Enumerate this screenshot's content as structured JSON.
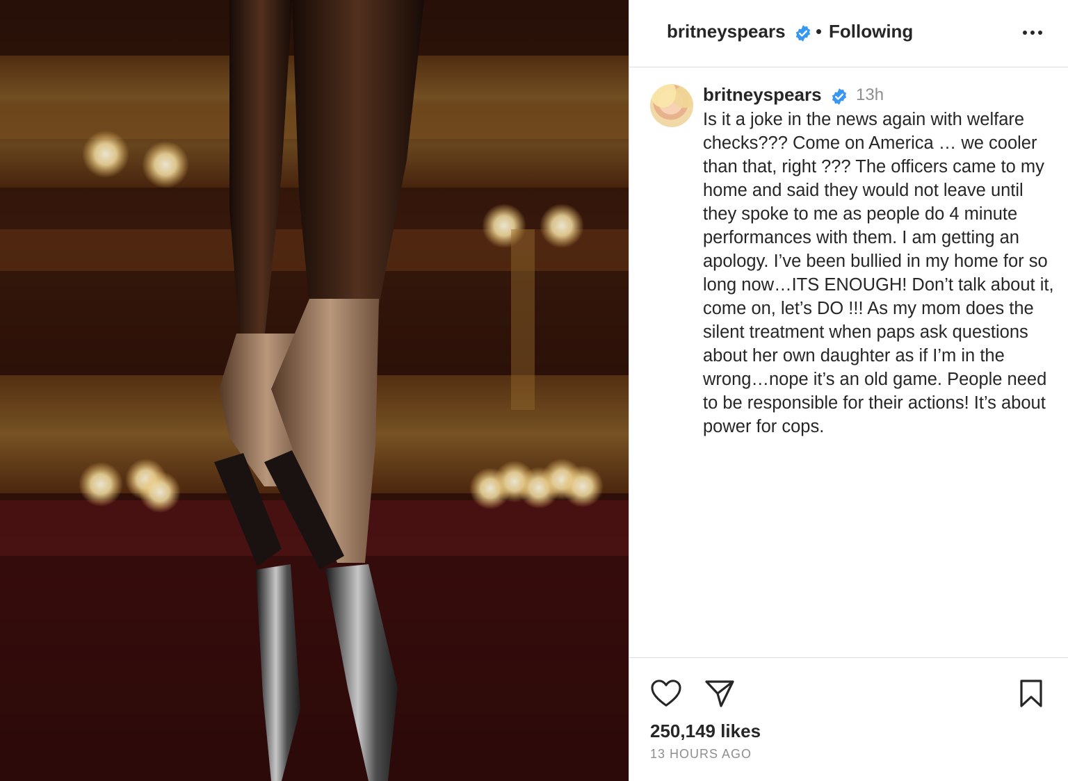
{
  "media": {
    "description_icon": "post-photo"
  },
  "header": {
    "username": "britneyspears",
    "verified_icon": "verified-badge-icon",
    "separator": "•",
    "follow_status": "Following",
    "more_icon": "more-options-icon"
  },
  "post": {
    "username": "britneyspears",
    "verified_icon": "verified-badge-icon",
    "time": "13h",
    "caption": "Is it a joke in the news again with welfare checks??? Come on America … we cooler than that, right ??? The officers came to my home and said they would not leave until they spoke to me as people do 4 minute performances with them. I am getting an apology. I’ve been bullied in my home for so long now…ITS ENOUGH! Don’t talk about it, come on, let’s DO !!! As my mom does the silent treatment when paps ask questions about her own daughter as if I’m in the wrong…nope it’s an old game. People need to be responsible for their actions! It’s about power for cops."
  },
  "footer": {
    "like_icon": "heart-icon",
    "share_icon": "paper-plane-icon",
    "save_icon": "bookmark-icon",
    "likes": "250,149 likes",
    "time_ago": "13 HOURS AGO"
  },
  "colors": {
    "verified": "#3897f0",
    "text": "#262626",
    "muted": "#8e8e8e",
    "divider": "#dbdbdb"
  }
}
